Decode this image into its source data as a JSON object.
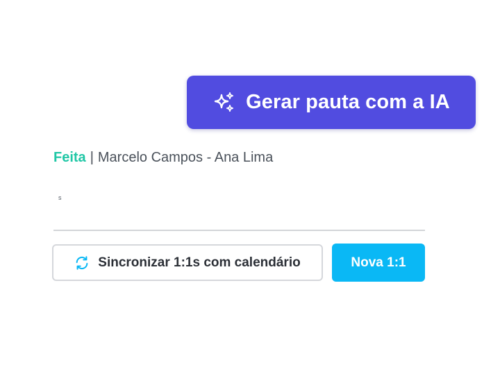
{
  "ai_button": {
    "label": "Gerar pauta com a IA",
    "icon": "sparkle-icon",
    "color": "#514ce0"
  },
  "meeting": {
    "status": "Feita",
    "separator": "|",
    "participants": "Marcelo Campos - Ana Lima",
    "status_color": "#20c7a6"
  },
  "note": {
    "text": "s"
  },
  "actions": {
    "sync_label": "Sincronizar 1:1s com calendário",
    "sync_icon": "refresh-icon",
    "sync_icon_color": "#0ab8f5",
    "new_label": "Nova 1:1",
    "new_color": "#0ab8f5"
  }
}
